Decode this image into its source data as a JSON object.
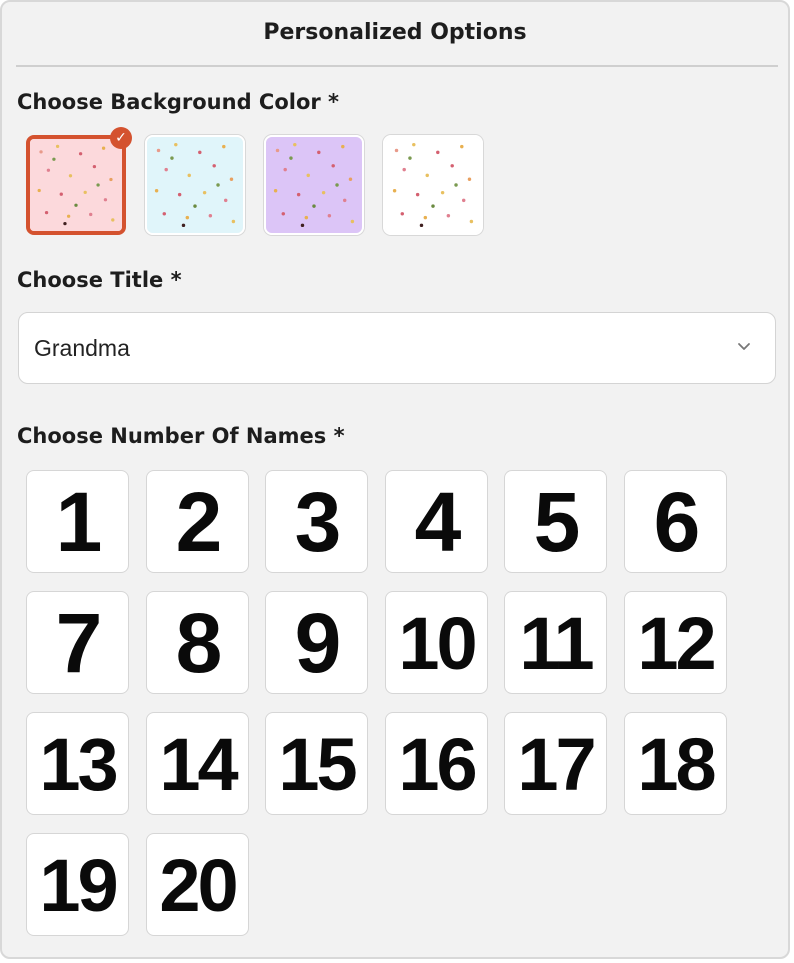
{
  "panel": {
    "title": "Personalized Options"
  },
  "background_color": {
    "label": "Choose Background Color *",
    "selected_index": 0,
    "options": [
      {
        "name": "pink",
        "color": "#fcd9dc"
      },
      {
        "name": "light-blue",
        "color": "#e0f5fa"
      },
      {
        "name": "lavender",
        "color": "#dcc5f7"
      },
      {
        "name": "white",
        "color": "#ffffff"
      }
    ]
  },
  "title_select": {
    "label": "Choose Title *",
    "value": "Grandma"
  },
  "number_of_names": {
    "label": "Choose Number Of Names *",
    "options": [
      "1",
      "2",
      "3",
      "4",
      "5",
      "6",
      "7",
      "8",
      "9",
      "10",
      "11",
      "12",
      "13",
      "14",
      "15",
      "16",
      "17",
      "18",
      "19",
      "20"
    ]
  },
  "colors": {
    "accent": "#d4522f",
    "panel_bg": "#f2f2f2"
  }
}
